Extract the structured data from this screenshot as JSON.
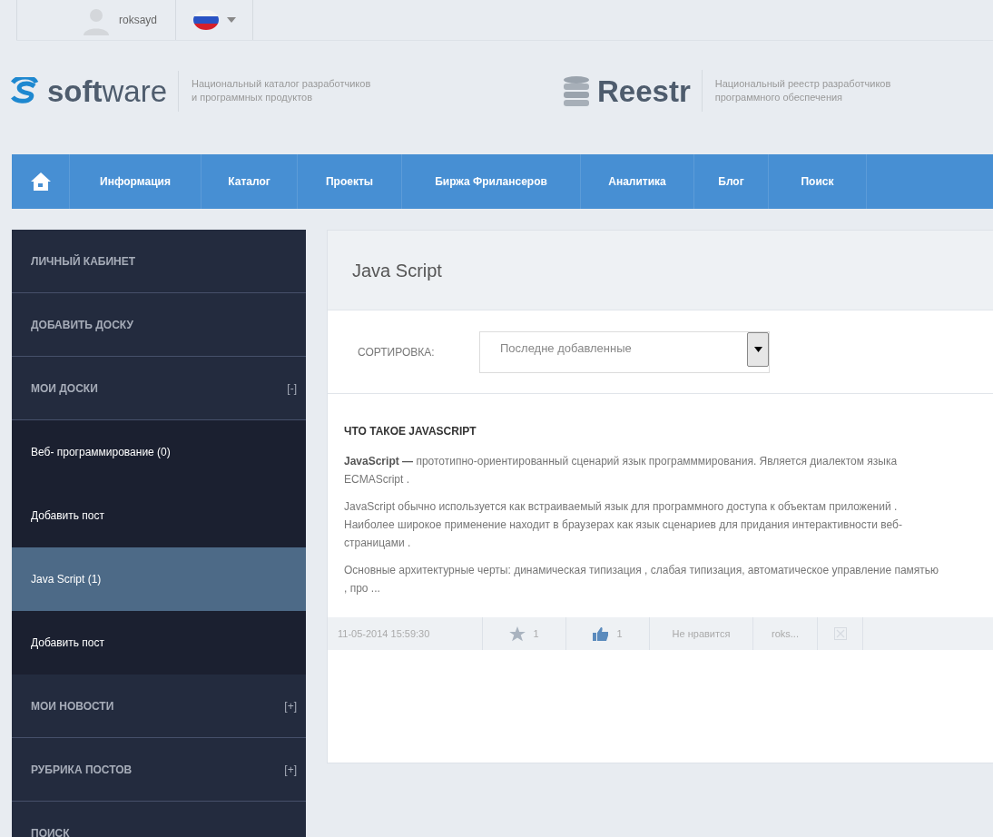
{
  "top_bar": {
    "username": "roksayd"
  },
  "header": {
    "logos": [
      {
        "kind": "software",
        "bold": "soft",
        "light": "ware",
        "tagline": [
          "Национальный каталог разработчиков",
          "и программных продуктов"
        ]
      },
      {
        "kind": "reestr",
        "bold": "Reestr",
        "tagline": [
          "Национальный реестр разработчиков",
          "программного обеспечения"
        ]
      }
    ]
  },
  "nav": {
    "items": [
      {
        "label": "Информация"
      },
      {
        "label": "Каталог"
      },
      {
        "label": "Проекты"
      },
      {
        "label": "Биржа Фрилансеров"
      },
      {
        "label": "Аналитика"
      },
      {
        "label": "Блог"
      },
      {
        "label": "Поиск"
      }
    ]
  },
  "sidebar": {
    "items": [
      {
        "label": "ЛИЧНЫЙ КАБИНЕТ",
        "kind": "section",
        "selected": false
      },
      {
        "label": "ДОБАВИТЬ ДОСКУ",
        "kind": "section",
        "selected": false
      },
      {
        "label": "МОИ ДОСКИ",
        "kind": "section",
        "toggle": "[-]",
        "selected": false
      },
      {
        "label": "Веб- программирование (0)",
        "kind": "sub",
        "selected": false
      },
      {
        "label": "Добавить пост",
        "kind": "sub",
        "selected": false
      },
      {
        "label": "Java Script (1)",
        "kind": "sub",
        "selected": true
      },
      {
        "label": "Добавить пост",
        "kind": "sub",
        "selected": false
      },
      {
        "label": "МОИ НОВОСТИ",
        "kind": "section",
        "toggle": "[+]",
        "selected": false
      },
      {
        "label": "РУБРИКА ПОСТОВ",
        "kind": "section",
        "toggle": "[+]",
        "selected": false
      },
      {
        "label": "ПОИСК",
        "kind": "section",
        "selected": false
      }
    ]
  },
  "main": {
    "title": "Java Script",
    "sort": {
      "label": "СОРТИРОВКА:",
      "value": "Последне добавленные"
    },
    "post": {
      "heading": "ЧТО ТАКОЕ JAVASCRIPT",
      "paragraphs": [
        "**JavaScript —** прототипно-ориентированный сценарий язык программмирования.  Является диалектом языка ECMAScript .",
        "JavaScript обычно используется как встраиваемый язык для программного доступа к объектам приложений . Наиболее широкое применение находит в браузерах как язык сценариев для придания интерактивности  веб-страницами .",
        "Основные архитектурные черты: динамическая типизация , слабая типизация, автоматическое управление памятью , про ..."
      ],
      "footer": {
        "date": "11-05-2014 15:59:30",
        "stars": "1",
        "likes": "1",
        "dislike": "Не нравится",
        "author": "roks..."
      }
    }
  }
}
